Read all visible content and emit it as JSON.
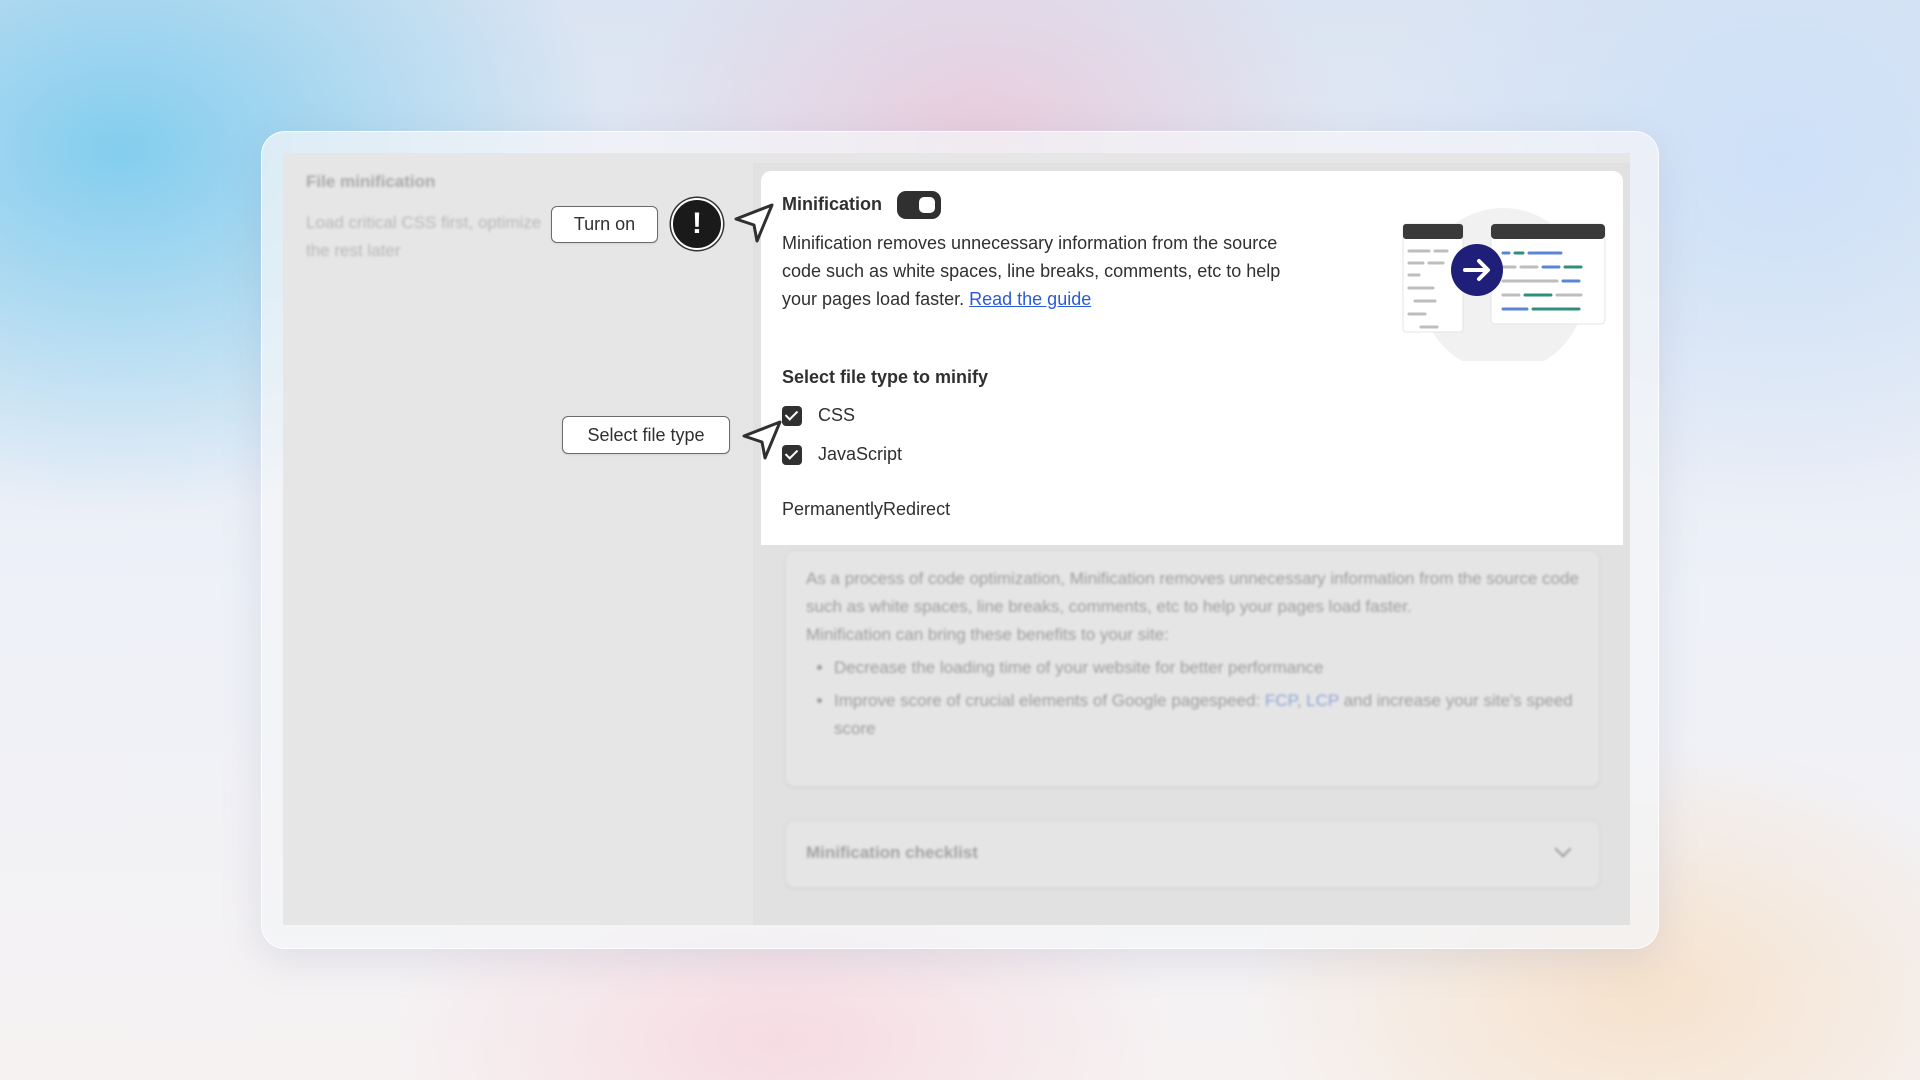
{
  "background_panel": {
    "title": "File minification",
    "description": "Load critical CSS first, optimize the rest later"
  },
  "minification": {
    "title": "Minification",
    "toggle_on": true,
    "description": "Minification removes unnecessary information from the source code such as white spaces, line breaks, comments, etc to help your pages load faster. ",
    "link_text": "Read the guide",
    "select_label": "Select file type to minify",
    "options": [
      {
        "label": "CSS",
        "checked": true
      },
      {
        "label": "JavaScript",
        "checked": true
      }
    ],
    "redirect_text": "PermanentlyRedirect"
  },
  "info_card": {
    "paragraph1": "As a process of code optimization, Minification removes unnecessary information from the source code such as white spaces, line breaks, comments, etc to help your pages load faster.",
    "paragraph2": "Minification can bring these benefits to your site:",
    "bullet1": "Decrease the loading time of your website for better performance",
    "bullet2_prefix": "Improve score of crucial elements of Google pagespeed: ",
    "bullet2_link1": "FCP",
    "bullet2_sep": ", ",
    "bullet2_link2": "LCP",
    "bullet2_suffix": " and increase your site's speed score"
  },
  "checklist": {
    "title": "Minification checklist"
  },
  "callouts": {
    "turn_on": "Turn on",
    "select_file_type": "Select file type",
    "alert_symbol": "!"
  },
  "colors": {
    "toggle": "#303030",
    "link": "#2a5bd7",
    "illustration_arrow": "#1f1f7a",
    "illustration_green": "#2f8f7a",
    "illustration_blue": "#5b86d6"
  },
  "icons": [
    "alert-icon",
    "cursor-arrow-icon",
    "checkbox-checked-icon",
    "chevron-down-icon",
    "arrow-right-icon"
  ]
}
